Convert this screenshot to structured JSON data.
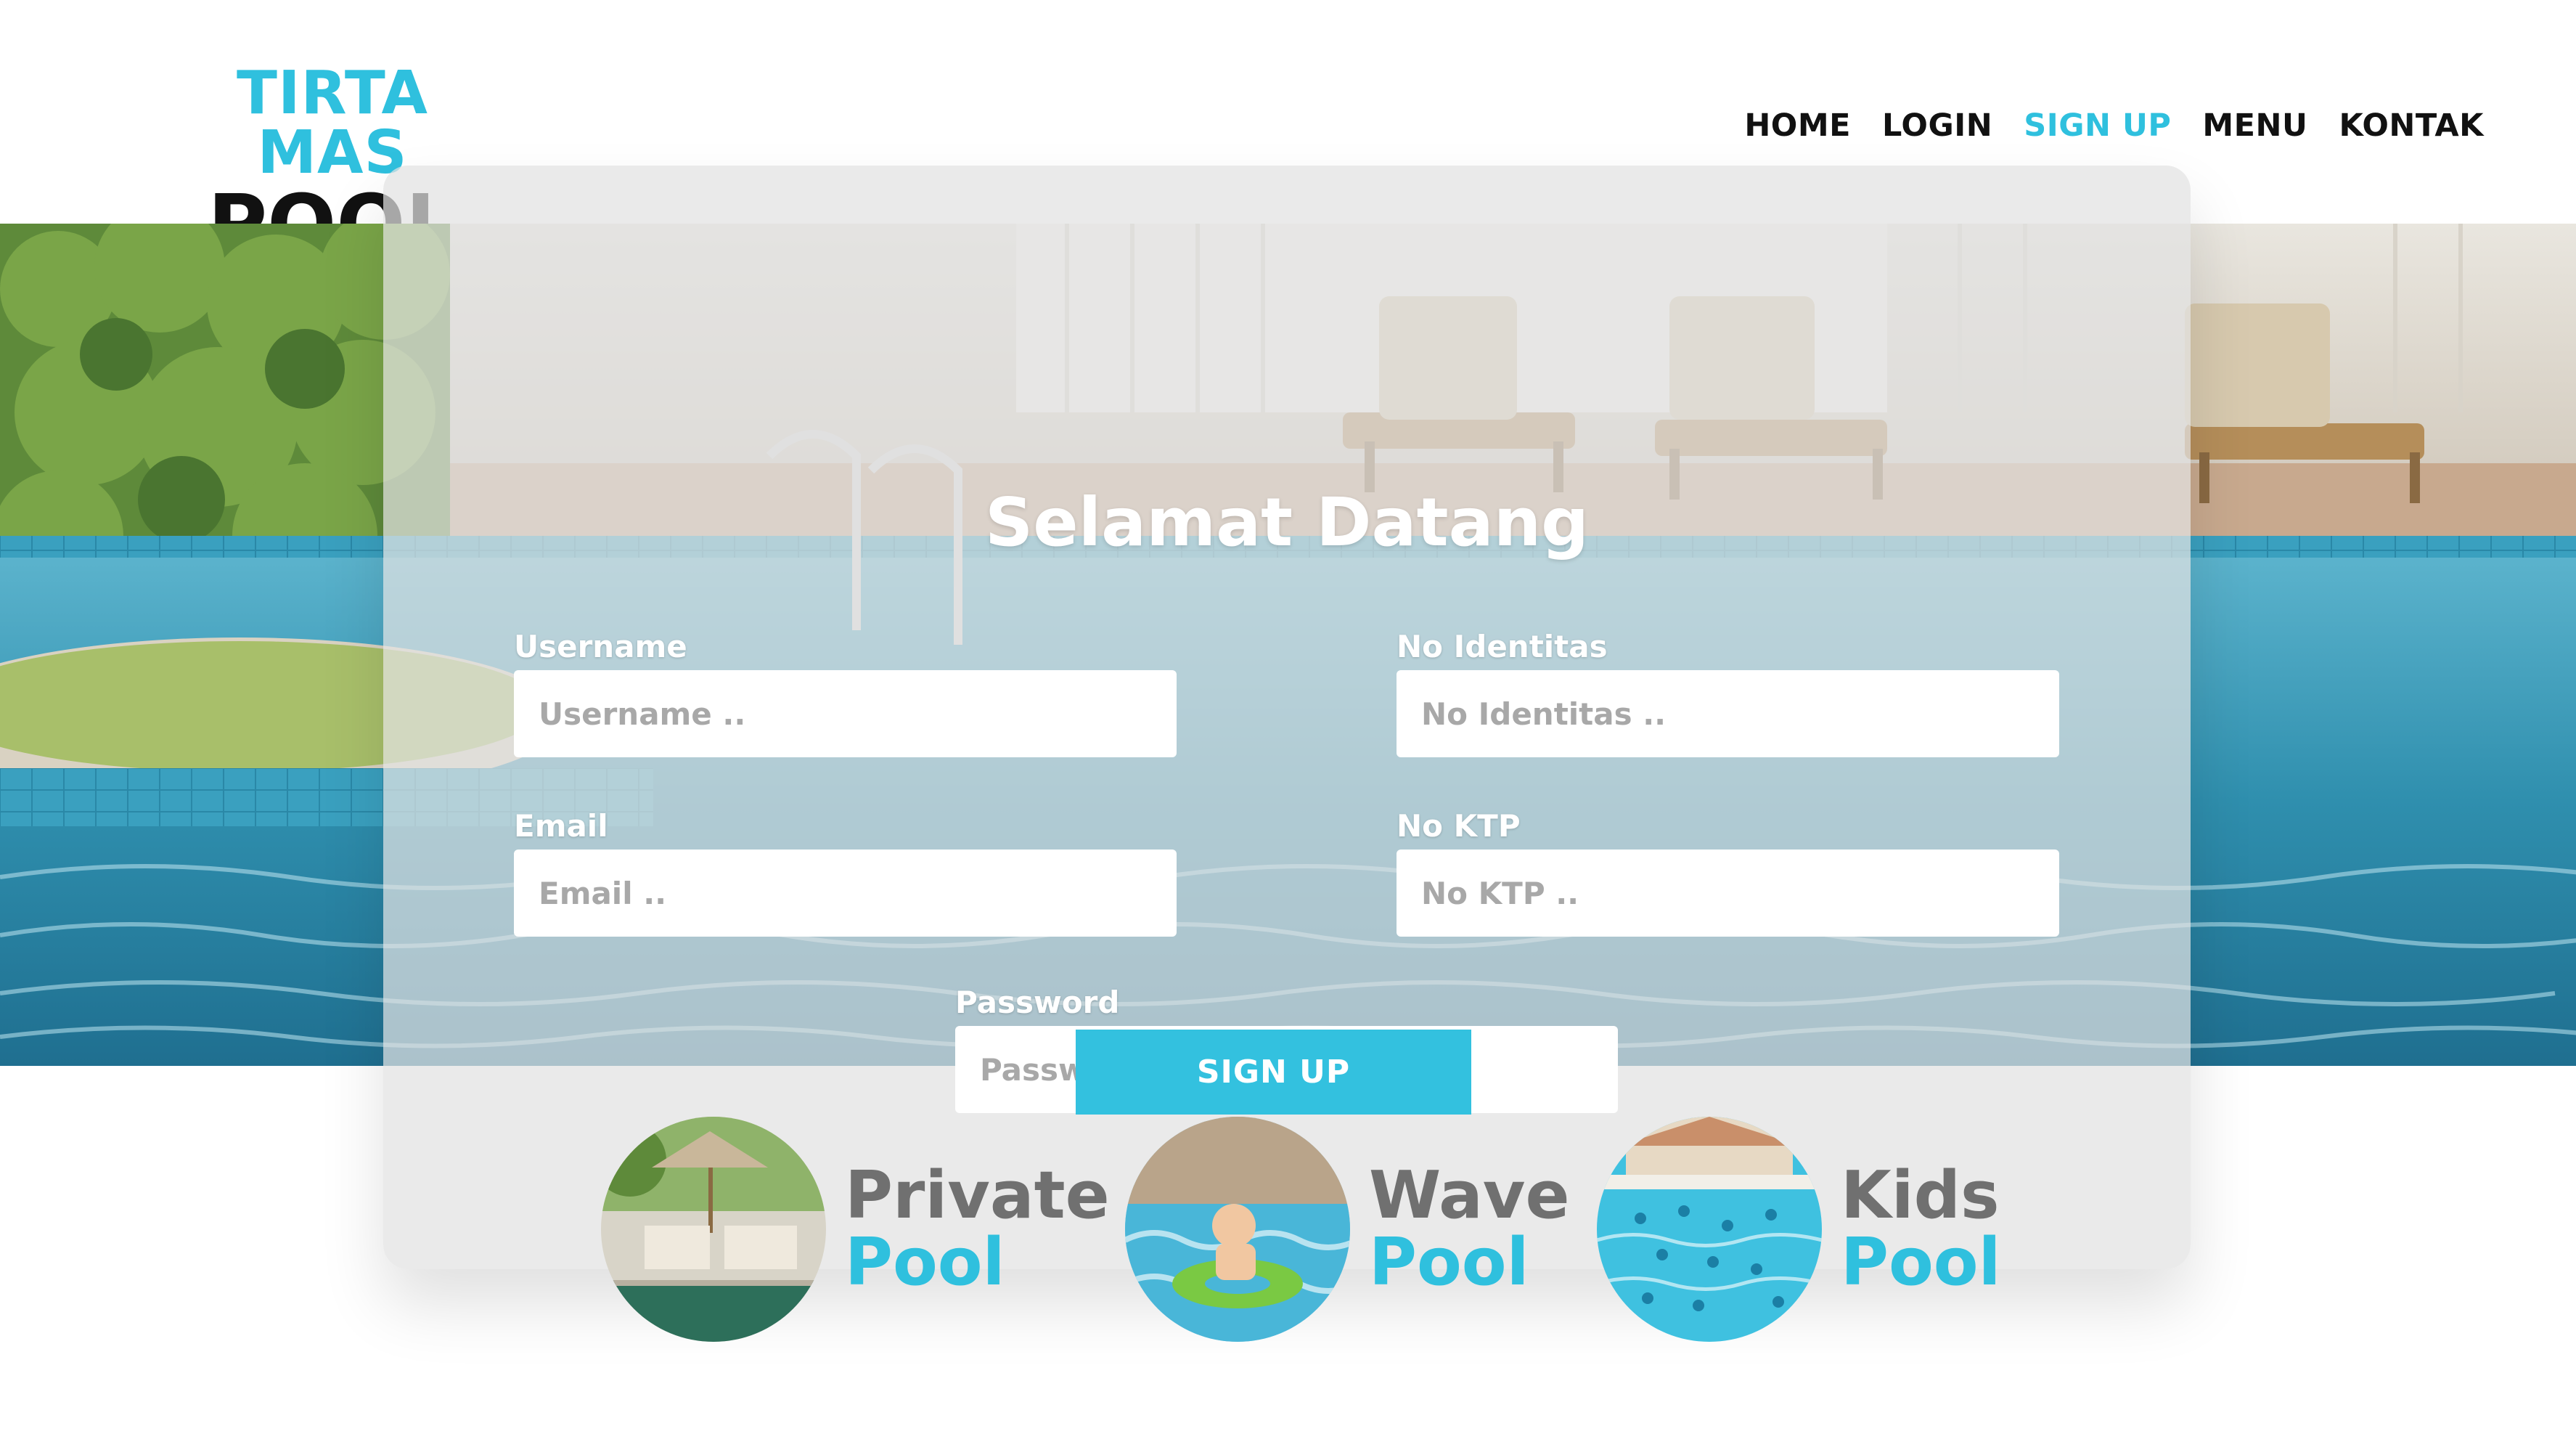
{
  "brand": {
    "line1": "TIRTA MAS",
    "line2": "POOL"
  },
  "nav": {
    "items": [
      {
        "label": "HOME"
      },
      {
        "label": "LOGIN"
      },
      {
        "label": "SIGN UP",
        "active": true
      },
      {
        "label": "MENU"
      },
      {
        "label": "KONTAK"
      }
    ]
  },
  "form": {
    "title": "Selamat Datang",
    "username": {
      "label": "Username",
      "placeholder": "Username .."
    },
    "no_identitas": {
      "label": "No Identitas",
      "placeholder": "No Identitas .."
    },
    "email": {
      "label": "Email",
      "placeholder": "Email .."
    },
    "no_ktp": {
      "label": "No KTP",
      "placeholder": "No KTP .."
    },
    "password": {
      "label": "Password",
      "placeholder": "Password .."
    },
    "submit_label": "SIGN UP"
  },
  "categories": [
    {
      "line1": "Private",
      "line2": "Pool"
    },
    {
      "line1": "Wave",
      "line2": "Pool"
    },
    {
      "line1": "Kids",
      "line2": "Pool"
    }
  ],
  "colors": {
    "accent": "#2fc0de",
    "dark": "#111111",
    "muted": "#707070"
  }
}
